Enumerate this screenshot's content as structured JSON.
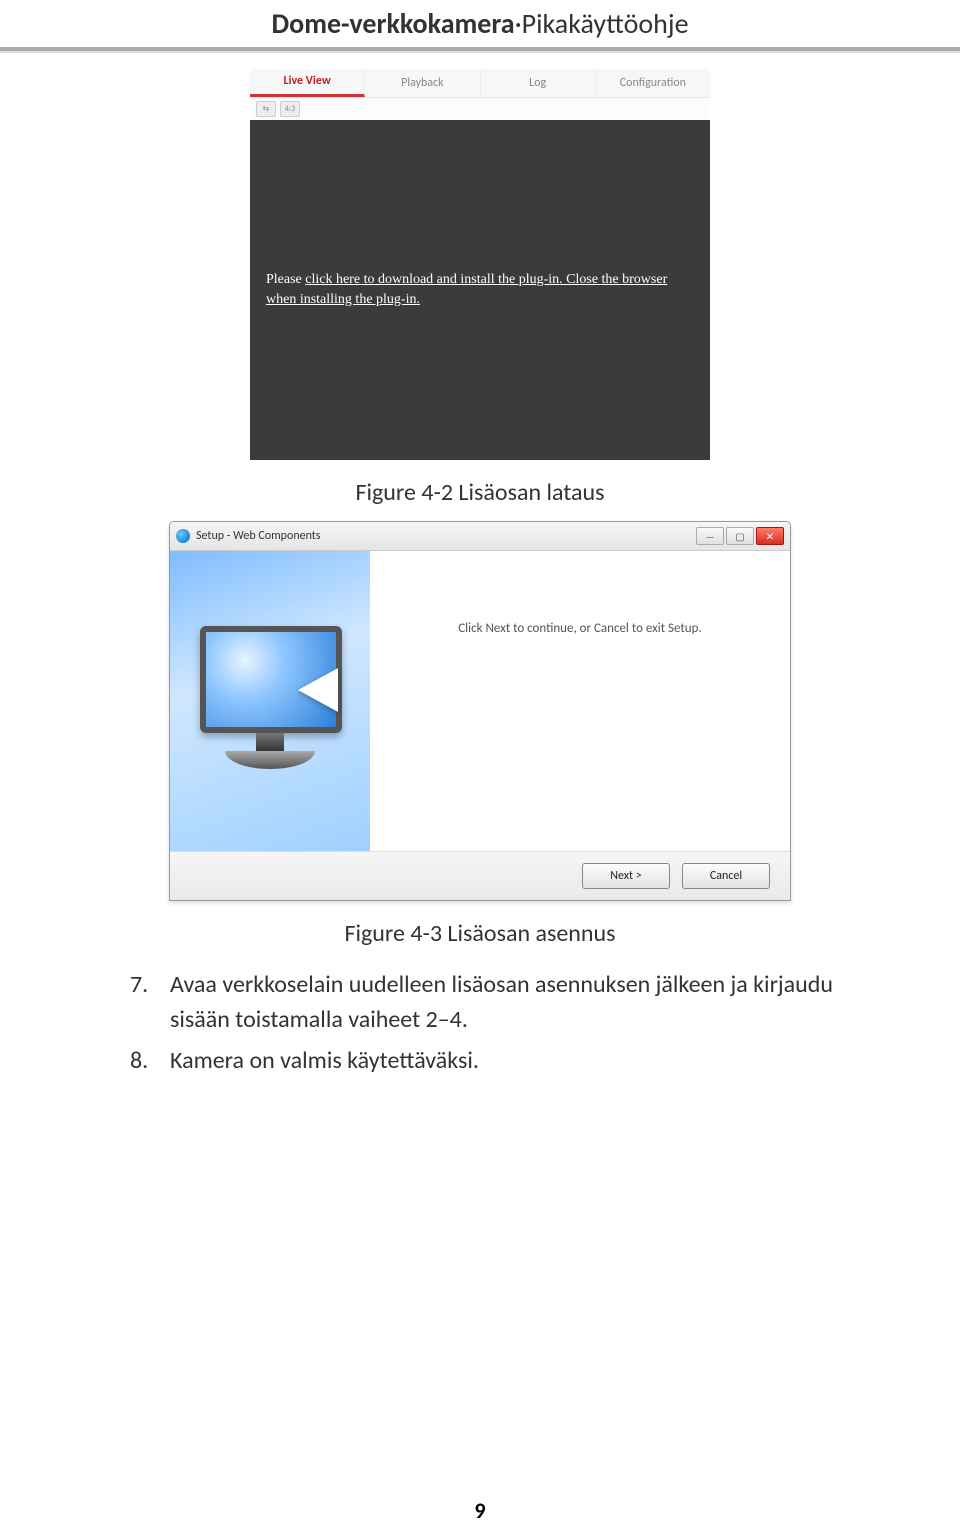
{
  "header": {
    "title_bold": "Dome-verkkokamera",
    "title_sep": "·",
    "title_rest": "Pikakäyttöohje"
  },
  "shot1": {
    "tabs": {
      "live": "Live View",
      "playback": "Playback",
      "log": "Log",
      "config": "Configuration"
    },
    "toolbar": {
      "b1": "⇆",
      "b2": "4:3"
    },
    "msg_before": "Please ",
    "msg_link": "click here to download and install the plug-in. Close the browser when installing the plug-in.",
    "caption": "Figure 4-2 Lisäosan lataus"
  },
  "wizard": {
    "title": "Setup - Web Components",
    "instr": "Click Next to continue, or Cancel to exit Setup.",
    "btn_next": "Next >",
    "btn_cancel": "Cancel",
    "caption": "Figure 4-3 Lisäosan asennus"
  },
  "list": {
    "items": [
      {
        "num": "7.",
        "text": "Avaa verkkoselain uudelleen lisäosan asennuksen jälkeen ja kirjaudu sisään toistamalla vaiheet 2–4."
      },
      {
        "num": "8.",
        "text": "Kamera on valmis käytettäväksi."
      }
    ]
  },
  "page_number": "9"
}
